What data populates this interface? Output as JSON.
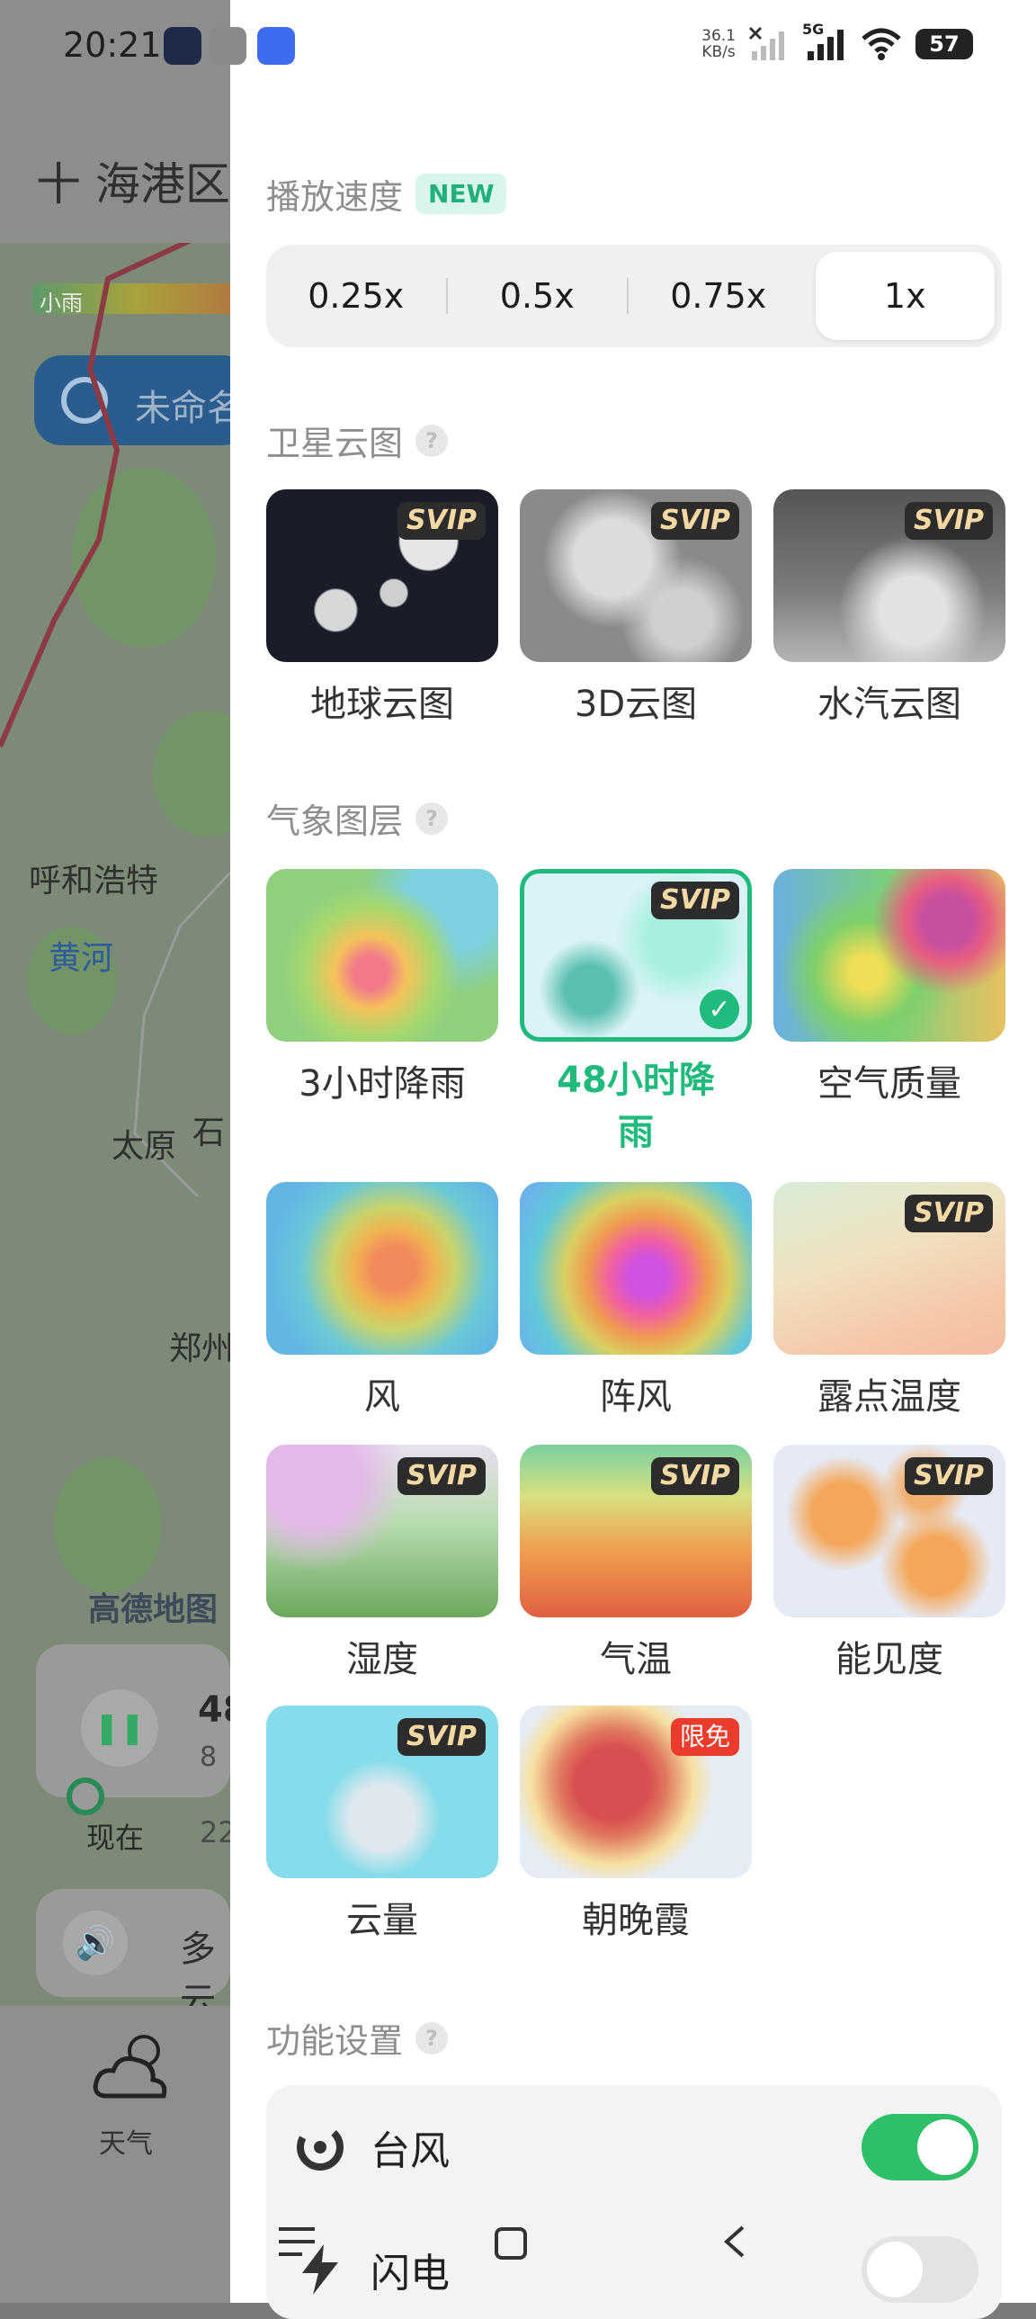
{
  "status_bar": {
    "time": "20:21",
    "net_speed": "36.1",
    "net_unit": "KB/s",
    "network": "5G",
    "battery": "57"
  },
  "background": {
    "location": "十 海港区",
    "legend_label": "小雨",
    "storm_label": "未命名",
    "places": [
      "呼和浩特",
      "黄河",
      "太原",
      "石",
      "郑州"
    ],
    "map_brand": "高德地图",
    "player_number": "48",
    "player_sub": "8",
    "player_now": "现在",
    "player_time": "22",
    "voice_text": "多云",
    "tab_weather": "天气"
  },
  "panel": {
    "speed": {
      "title": "播放速度",
      "badge": "NEW",
      "options": [
        "0.25x",
        "0.5x",
        "0.75x",
        "1x"
      ],
      "selected": "1x"
    },
    "satellite": {
      "title": "卫星云图",
      "items": [
        {
          "label": "地球云图",
          "badge": "SVIP"
        },
        {
          "label": "3D云图",
          "badge": "SVIP"
        },
        {
          "label": "水汽云图",
          "badge": "SVIP"
        }
      ]
    },
    "layers": {
      "title": "气象图层",
      "items": [
        {
          "label": "3小时降雨",
          "badge": ""
        },
        {
          "label": "48小时降雨",
          "badge": "SVIP"
        },
        {
          "label": "空气质量",
          "badge": ""
        },
        {
          "label": "风",
          "badge": ""
        },
        {
          "label": "阵风",
          "badge": ""
        },
        {
          "label": "露点温度",
          "badge": "SVIP"
        },
        {
          "label": "湿度",
          "badge": "SVIP"
        },
        {
          "label": "气温",
          "badge": "SVIP"
        },
        {
          "label": "能见度",
          "badge": "SVIP"
        },
        {
          "label": "云量",
          "badge": "SVIP"
        },
        {
          "label": "朝晚霞",
          "badge": "限免"
        }
      ],
      "selected": "48小时降雨"
    },
    "functions": {
      "title": "功能设置",
      "items": [
        {
          "label": "台风",
          "enabled": true
        },
        {
          "label": "闪电",
          "enabled": false
        }
      ]
    }
  },
  "colors": {
    "accent": "#1fba7c",
    "toggle_on": "#2dc069",
    "svip_bg": "#2c2c2c",
    "svip_text": "#f5d9a5",
    "free_badge": "#ea3b2c"
  }
}
